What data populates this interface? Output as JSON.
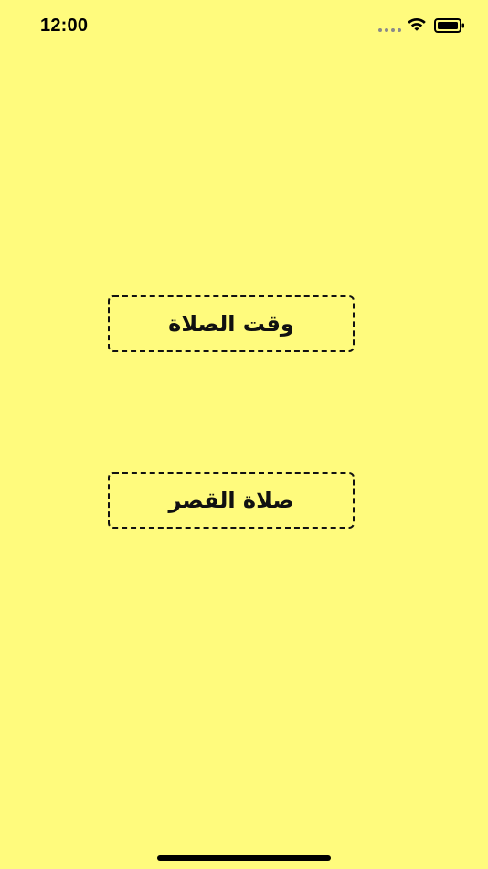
{
  "status_bar": {
    "time": "12:00",
    "icons": [
      "cellular-signal-icon",
      "wifi-icon",
      "battery-icon"
    ]
  },
  "buttons": [
    {
      "label": "وقت الصلاة"
    },
    {
      "label": "صلاة القصر"
    }
  ],
  "colors": {
    "background": "#fffb7d",
    "border": "#111111",
    "text": "#111111"
  }
}
